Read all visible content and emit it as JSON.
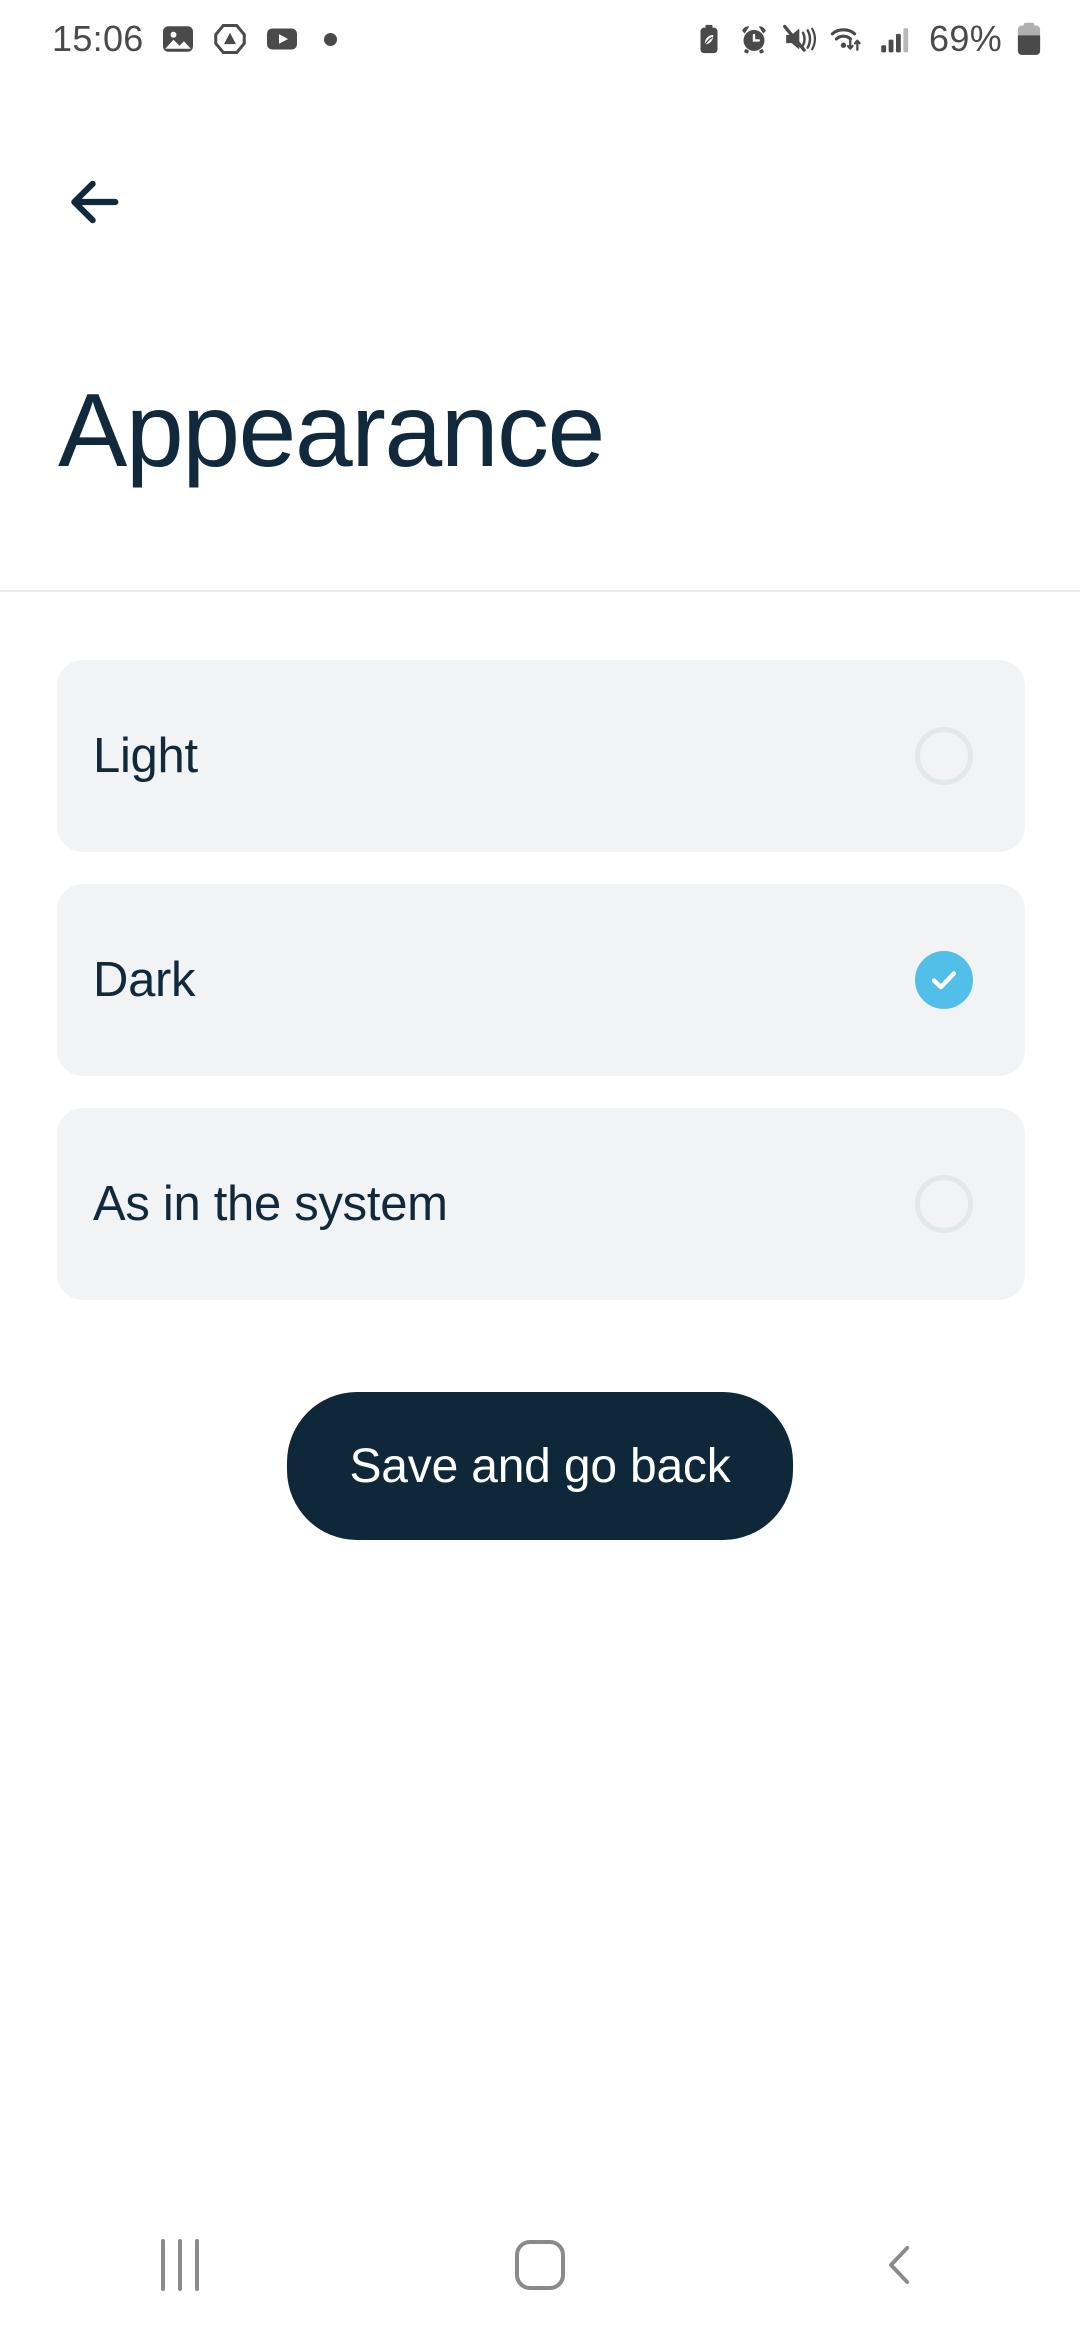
{
  "status_bar": {
    "time": "15:06",
    "battery_percent": "69%",
    "left_icons": [
      {
        "name": "gallery-photo-icon"
      },
      {
        "name": "affinity-triangle-icon"
      },
      {
        "name": "youtube-play-icon"
      },
      {
        "name": "notification-dot-icon"
      }
    ],
    "right_icons": [
      {
        "name": "battery-saver-leaf-icon"
      },
      {
        "name": "alarm-clock-icon"
      },
      {
        "name": "volume-vibrate-mute-icon"
      },
      {
        "name": "wifi-data-transfer-icon"
      },
      {
        "name": "cellular-signal-icon"
      },
      {
        "name": "battery-icon"
      }
    ]
  },
  "header": {
    "back_icon": "arrow-left-icon",
    "title": "Appearance"
  },
  "options": [
    {
      "id": "light",
      "label": "Light",
      "selected": false
    },
    {
      "id": "dark",
      "label": "Dark",
      "selected": true
    },
    {
      "id": "system",
      "label": "As in the system",
      "selected": false
    }
  ],
  "actions": {
    "save_label": "Save and go back"
  },
  "nav_bar": {
    "recents_icon": "recents-bars-icon",
    "home_icon": "home-square-icon",
    "back_icon": "chevron-left-icon"
  },
  "colors": {
    "text_primary": "#11293c",
    "accent_selected": "#51bfe8",
    "card_bg": "#f1f3f5",
    "button_bg": "#0e2739",
    "page_bg": "#ffffff",
    "divider": "#e9ecee",
    "radio_outline": "#e2e7ea",
    "status_icon": "#4a4a4a",
    "nav_icon": "#8a8a8a"
  }
}
